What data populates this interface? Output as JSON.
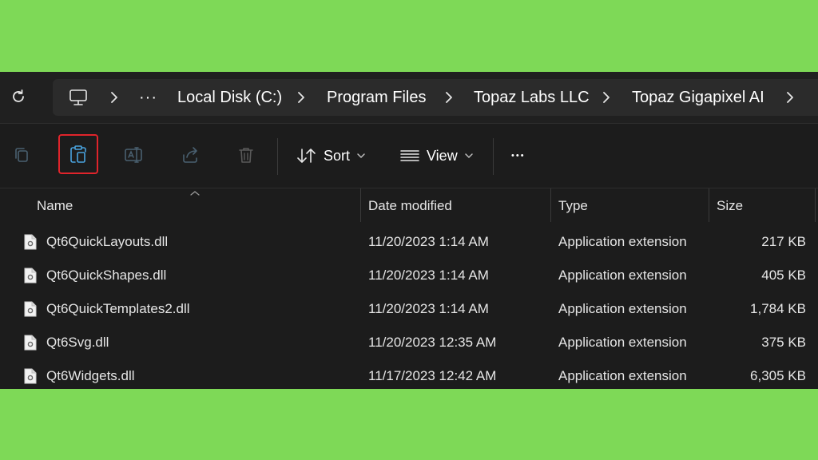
{
  "breadcrumb": {
    "overflow": "···",
    "items": [
      "Local Disk (C:)",
      "Program Files",
      "Topaz Labs LLC",
      "Topaz Gigapixel AI"
    ]
  },
  "toolbar": {
    "sort_label": "Sort",
    "view_label": "View",
    "more_label": "•••",
    "highlighted": "paste"
  },
  "columns": {
    "name": "Name",
    "date": "Date modified",
    "type": "Type",
    "size": "Size"
  },
  "files": [
    {
      "name": "Qt6QuickLayouts.dll",
      "date": "11/20/2023 1:14 AM",
      "type": "Application extension",
      "size": "217 KB"
    },
    {
      "name": "Qt6QuickShapes.dll",
      "date": "11/20/2023 1:14 AM",
      "type": "Application extension",
      "size": "405 KB"
    },
    {
      "name": "Qt6QuickTemplates2.dll",
      "date": "11/20/2023 1:14 AM",
      "type": "Application extension",
      "size": "1,784 KB"
    },
    {
      "name": "Qt6Svg.dll",
      "date": "11/20/2023 12:35 AM",
      "type": "Application extension",
      "size": "375 KB"
    },
    {
      "name": "Qt6Widgets.dll",
      "date": "11/17/2023 12:42 AM",
      "type": "Application extension",
      "size": "6,305 KB"
    }
  ],
  "colors": {
    "background": "#7ed957",
    "window": "#1c1c1c",
    "highlight": "#e0242b",
    "accent_icon": "#4aa3df"
  }
}
